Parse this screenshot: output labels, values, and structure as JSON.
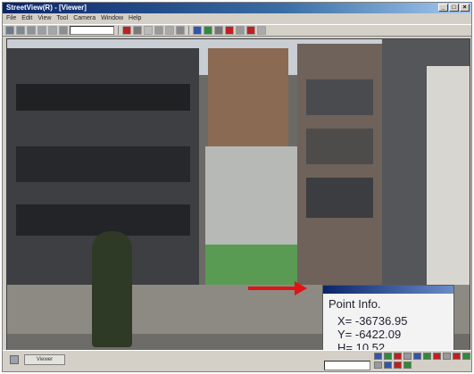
{
  "window": {
    "title": "StreetView(R) - [Viewer]",
    "controls": [
      "_",
      "□",
      "×"
    ]
  },
  "menu": [
    "File",
    "Edit",
    "View",
    "Tool",
    "Camera",
    "Window",
    "Help"
  ],
  "toolbar": {
    "button_icons": [
      "open-icon",
      "save-icon",
      "print-icon",
      "cut-icon",
      "copy-icon",
      "paste-icon"
    ],
    "right_icons": [
      "zoom-in-icon",
      "zoom-out-icon",
      "pan-icon",
      "measure-icon",
      "point-icon",
      "line-icon",
      "area-icon",
      "grid-icon",
      "settings-icon",
      "record-icon",
      "stop-icon",
      "play-icon",
      "help-icon"
    ],
    "colors": {
      "accent": "#c02020",
      "neutral": "#7a7a7a",
      "blue": "#3355aa",
      "green": "#2f8a3a"
    }
  },
  "point_info": {
    "heading": "Point Info.",
    "x": "X= -36736.95",
    "y": "Y= -6422.09",
    "h": "H= 10.52"
  },
  "status": {
    "tab_label": "Viewer"
  },
  "colors": {
    "arrow": "#e01414",
    "title_bar": "#0a246a"
  }
}
